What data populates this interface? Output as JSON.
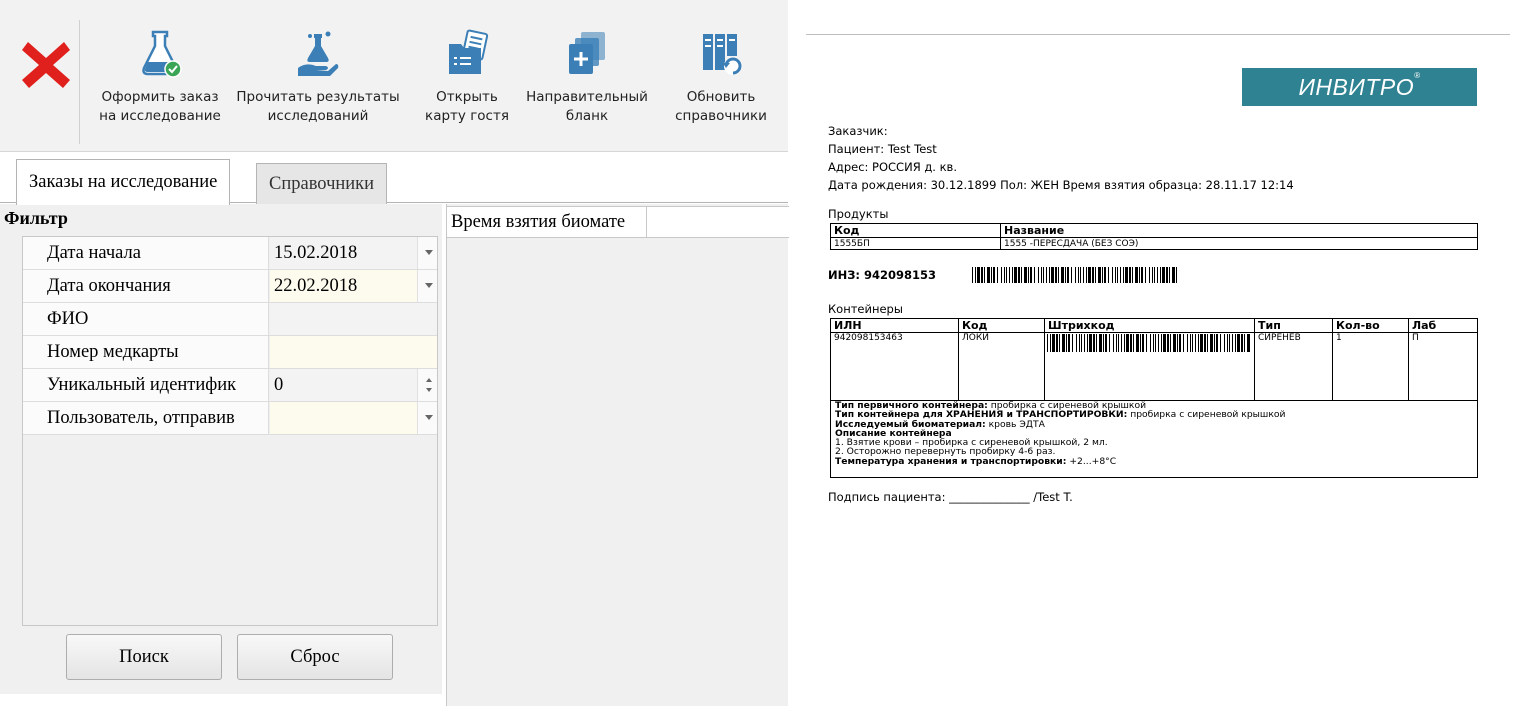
{
  "toolbar": {
    "buttons": [
      {
        "label": "Оформить заказ\nна исследование",
        "icon": "flask-check-icon"
      },
      {
        "label": "Прочитать результаты\nисследований",
        "icon": "hand-flask-icon"
      },
      {
        "label": "Открыть\nкарту гостя",
        "icon": "folder-card-icon"
      },
      {
        "label": "Направительный\nбланк",
        "icon": "document-plus-icon"
      },
      {
        "label": "Обновить\nсправочники",
        "icon": "books-refresh-icon"
      }
    ],
    "close_icon": "red-x-icon"
  },
  "tabs": [
    {
      "label": "Заказы на исследование",
      "active": true
    },
    {
      "label": "Справочники",
      "active": false
    }
  ],
  "filter": {
    "title": "Фильтр",
    "rows": [
      {
        "label": "Дата начала",
        "value": "15.02.2018",
        "control": "dropdown"
      },
      {
        "label": "Дата окончания",
        "value": "22.02.2018",
        "control": "dropdown"
      },
      {
        "label": "ФИО",
        "value": "",
        "control": "text"
      },
      {
        "label": "Номер медкарты",
        "value": "",
        "control": "text"
      },
      {
        "label": "Уникальный идентифик",
        "value": "0",
        "control": "spinner"
      },
      {
        "label": "Пользователь, отправив",
        "value": "",
        "control": "dropdown"
      }
    ],
    "search_button": "Поиск",
    "reset_button": "Сброс"
  },
  "orders_grid": {
    "column_header": "Время взятия биомате"
  },
  "document": {
    "logo": "ИНВИТРО",
    "logo_mark": "®",
    "customer": "Заказчик:",
    "patient": "Пациент: Test  Test",
    "address": "Адрес: РОССИЯ     д.  кв.",
    "birth_line": "Дата рождения: 30.12.1899 Пол: ЖЕН Время взятия образца: 28.11.17 12:14",
    "products_title": "Продукты",
    "products_headers": [
      "Код",
      "Название"
    ],
    "products_rows": [
      [
        "1555БП",
        "1555 -ПЕРЕСДАЧА (БЕЗ СОЭ)"
      ]
    ],
    "inz": "ИНЗ: 942098153",
    "containers_title": "Контейнеры",
    "containers_headers": [
      "ИЛН",
      "Код",
      "Штрихкод",
      "Тип",
      "Кол-во",
      "Лаб"
    ],
    "containers_rows": [
      [
        "942098153463",
        "ЛОКИ",
        "",
        "СИРЕНЕВ",
        "1",
        "П"
      ]
    ],
    "notes": {
      "primary_label": "Тип первичного контейнера:",
      "primary_value": " пробирка с сиреневой крышкой",
      "storage_label": "Тип контейнера для ХРАНЕНИЯ и ТРАНСПОРТИРОВКИ:",
      "storage_value": " пробирка с сиреневой крышкой",
      "biomaterial_label": "Исследуемый биоматериал:",
      "biomaterial_value": " кровь ЭДТА",
      "description_label": "Описание контейнера",
      "step1": "1. Взятие крови – пробирка с сиреневой крышкой, 2 мл.",
      "step2": "2. Осторожно перевернуть пробирку 4-6 раз.",
      "temp_label": "Температура хранения и транспортировки:",
      "temp_value": " +2...+8°С"
    },
    "signature": "Подпись пациента: ______________ /Test T."
  },
  "colors": {
    "logo_bg": "#2f8291",
    "close_red": "#e0201c",
    "icon_blue": "#3b7fb6",
    "check_green": "#3aa655"
  }
}
